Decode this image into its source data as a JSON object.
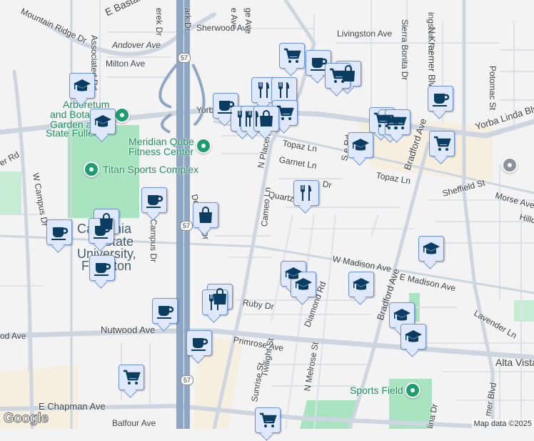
{
  "streets": {
    "mountain_ridge": "Mountain Ridge Dr",
    "bastanchury": "E Bastanchury",
    "sherwood": "Sherwood Ave",
    "livingston": "Livingston Ave",
    "andover": "Andover Ave",
    "milton": "Milton Ave",
    "associated": "Associated Rd",
    "yorba_w": "Yorb",
    "yorba_e": "Yorba Linda Blvd",
    "topaz1": "Topaz Ln",
    "topaz2": "Topaz Ln",
    "garnet": "Garnet Ln",
    "quartz": "Quartz",
    "placentia": "N Placen",
    "sierra_bonita": "Sierra Bonita Dr",
    "livingston_rd": "ingston Rd",
    "kraemer_n": "N Kraemer Blvd",
    "kraemer_s": "mer Blvd",
    "potomac": "Potomac St",
    "bradford": "Bradford Ave",
    "bradford2": "Bradford Ave",
    "sheffield": "Sheffield St",
    "morse": "Morse Ave",
    "hillcrest": "Hillcr",
    "deerpark": "Deerpark Dr",
    "w_campus": "W Campus Dr",
    "e_campus": "E Campus Dr",
    "cameo": "Cameo Ln",
    "w_madison": "W Madison Ave",
    "e_madison": "E Madison Ave",
    "ruby": "Ruby Dr",
    "primrose": "Primrose Ave",
    "nutwood": "Nutwood Ave",
    "nutwood_w": "od Ave",
    "diamond": "Diamond Rd",
    "twilight": "Twilight St",
    "melrose": "N Melrose St",
    "sunrise": "Sunrise St",
    "lavender": "Lavender Ln",
    "alta_vista": "Alta Vista",
    "chapman": "E Chapman Ave",
    "balfour": "Balfour Ave",
    "derek": "erek Dr",
    "park_dr": "ark Dr",
    "ge_ave": "ge Ave",
    "e_ave": "e Ave",
    "er_rd": "er Rd",
    "lina": "lina Dr",
    "dr_frag": "Dr",
    "s_rd": "S     e Rd"
  },
  "pois": {
    "arboretum": "Arboretum and Botanical Garden at Cal State Fullerton",
    "arboretum_l1": "Arboretum",
    "arboretum_l2": "and Bota",
    "arboretum_l3": "Garden a",
    "arboretum_l4": "State Fuller",
    "meridian_l1": "Meridian Qube",
    "meridian_l2": "Fitness Center",
    "titan": "Titan Sports Complex",
    "csuf_l1": "California",
    "csuf_l2": "State",
    "csuf_l3": "University,",
    "csuf_l4": "Fullerton",
    "sports_field": "Sports Field"
  },
  "highway": "57",
  "markers": [
    {
      "icon": "school-icon"
    },
    {
      "icon": "school-icon"
    },
    {
      "icon": "coffee-icon"
    },
    {
      "icon": "coffee-icon"
    },
    {
      "icon": "shopping-bag-icon"
    },
    {
      "icon": "coffee-icon"
    },
    {
      "icon": "coffee-icon"
    },
    {
      "icon": "coffee-icon"
    },
    {
      "icon": "coffee-icon"
    },
    {
      "icon": "cart-icon"
    },
    {
      "icon": "shopping-bag-icon"
    },
    {
      "icon": "shopping-bag-icon"
    },
    {
      "icon": "restaurant-icon"
    },
    {
      "icon": "coffee-icon"
    },
    {
      "icon": "restaurant-icon"
    },
    {
      "icon": "restaurant-icon"
    },
    {
      "icon": "restaurant-icon"
    },
    {
      "icon": "restaurant-icon"
    },
    {
      "icon": "cart-icon"
    },
    {
      "icon": "cart-icon"
    },
    {
      "icon": "shopping-bag-icon"
    },
    {
      "icon": "coffee-icon"
    },
    {
      "icon": "shopping-bag-icon"
    },
    {
      "icon": "cart-icon"
    },
    {
      "icon": "cart-icon"
    },
    {
      "icon": "cart-icon"
    },
    {
      "icon": "cart-icon"
    },
    {
      "icon": "coffee-icon"
    },
    {
      "icon": "cart-icon"
    },
    {
      "icon": "school-icon"
    },
    {
      "icon": "restaurant-icon"
    },
    {
      "icon": "school-icon"
    },
    {
      "icon": "school-icon"
    },
    {
      "icon": "school-icon"
    },
    {
      "icon": "school-icon"
    },
    {
      "icon": "school-icon"
    },
    {
      "icon": "school-icon"
    },
    {
      "icon": "cart-icon"
    }
  ],
  "attribution": {
    "logo": "Google",
    "map_data": "Map data ©2025"
  }
}
